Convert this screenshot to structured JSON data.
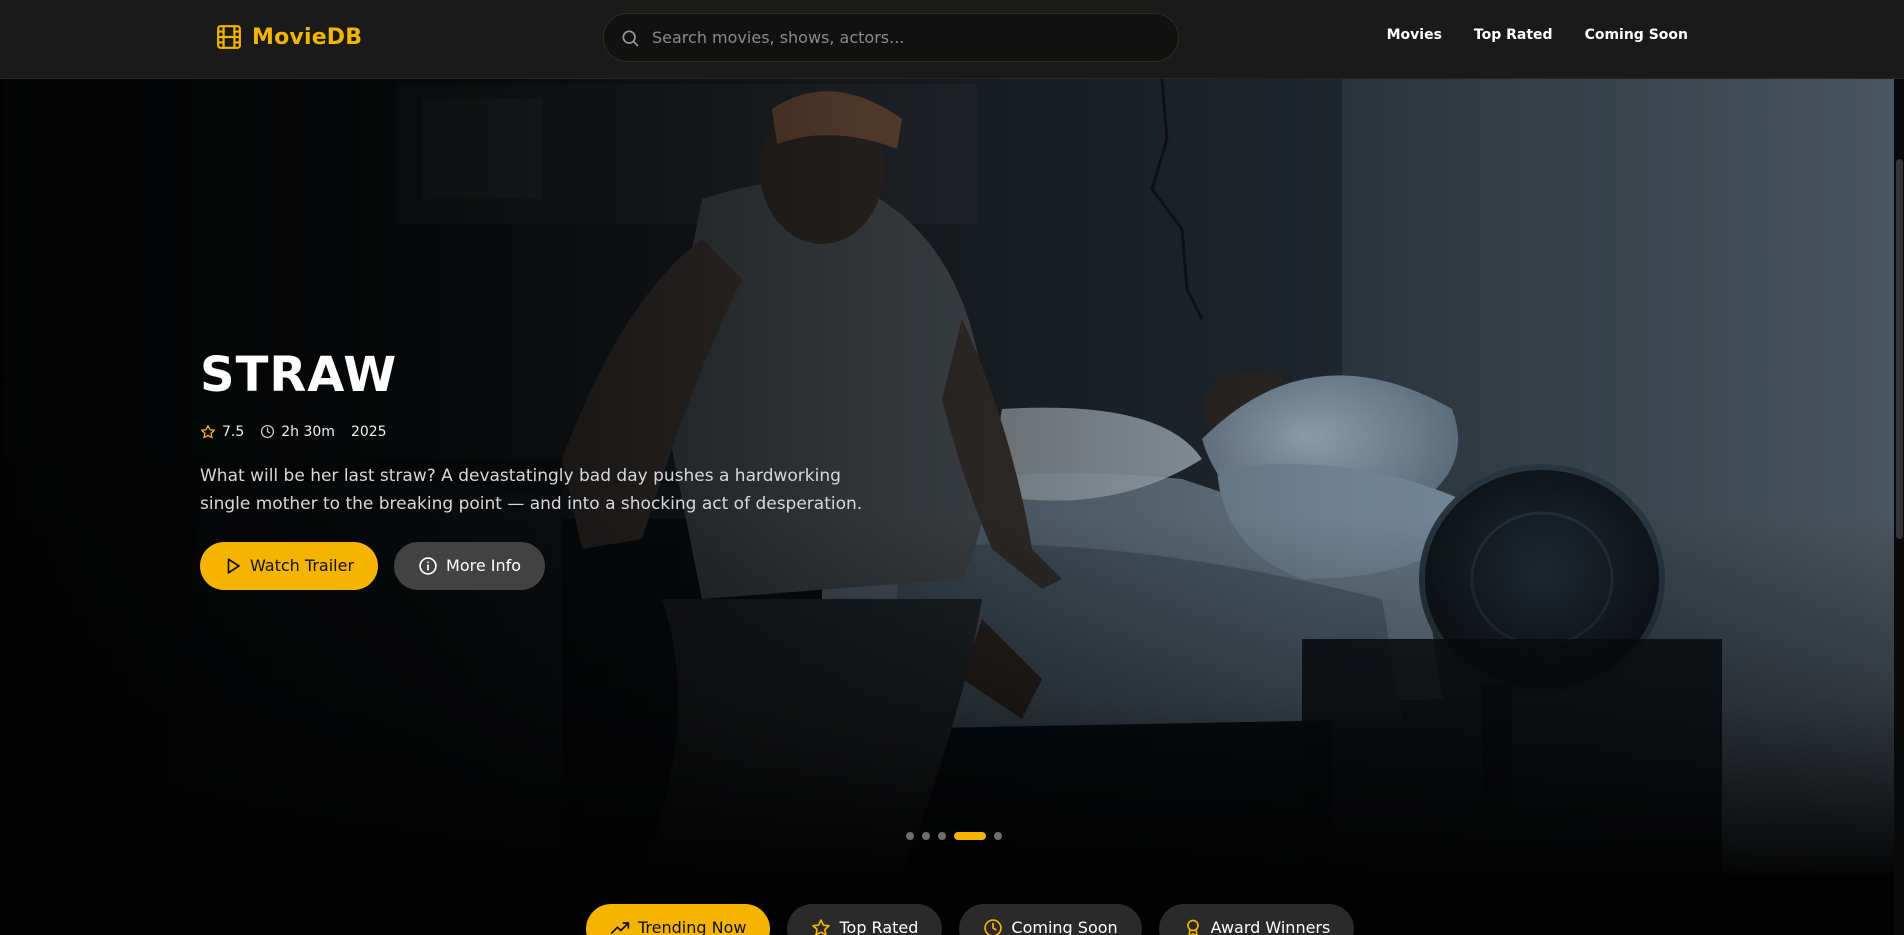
{
  "header": {
    "brand": "MovieDB",
    "search_placeholder": "Search movies, shows, actors...",
    "nav": [
      "Movies",
      "Top Rated",
      "Coming Soon"
    ]
  },
  "hero": {
    "title": "STRAW",
    "rating": "7.5",
    "runtime": "2h 30m",
    "year": "2025",
    "description": "What will be her last straw? A devastatingly bad day pushes a hardworking single mother to the breaking point — and into a shocking act of desperation.",
    "primary_button": "Watch Trailer",
    "secondary_button": "More Info",
    "slide_count": 5,
    "active_slide": 4
  },
  "categories": [
    "Trending Now",
    "Top Rated",
    "Coming Soon",
    "Award Winners"
  ],
  "icons": {
    "brand": "film-icon",
    "search": "search-icon",
    "rating": "star-icon",
    "runtime": "clock-icon",
    "primary_button": "play-icon",
    "secondary_button": "info-icon",
    "categories": [
      "trending-up-icon",
      "star-icon",
      "clock-icon",
      "award-icon"
    ]
  },
  "colors": {
    "accent": "#f5b400",
    "header_bg": "#1a1a1a",
    "page_bg": "#020202",
    "secondary_button_bg": "#484848"
  }
}
